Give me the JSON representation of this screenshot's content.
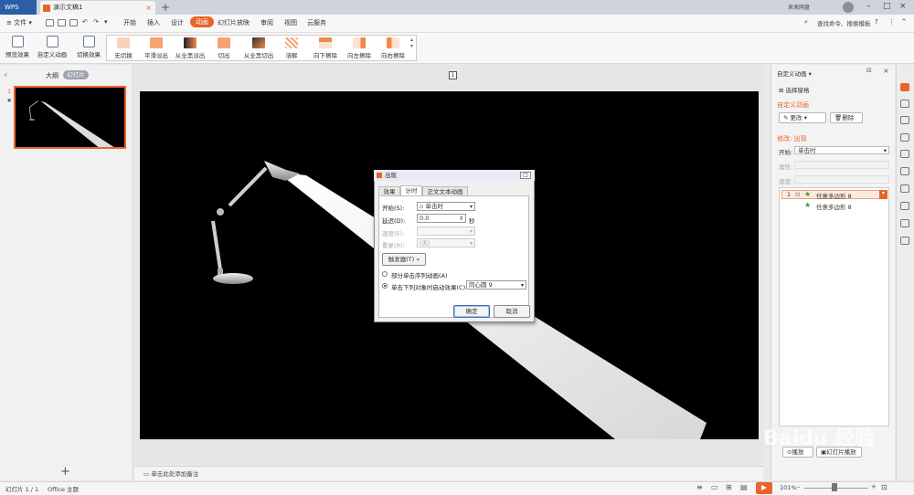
{
  "app": {
    "name": "WPS",
    "doc_tab": "演示文稿1",
    "user": "来来网盘"
  },
  "menu": {
    "file": "文件",
    "items": [
      "开始",
      "插入",
      "设计",
      "动画",
      "幻灯片放映",
      "审阅",
      "视图",
      "云服务"
    ],
    "active": "动画",
    "search": "查找命令、搜索模板"
  },
  "ribbon": {
    "left_buttons": [
      "预览效果",
      "自定义动画",
      "切换效果"
    ],
    "effects": [
      "无切换",
      "平滑淡出",
      "从全黑淡出",
      "切出",
      "从全黑切出",
      "溶解",
      "向下擦除",
      "向左擦除",
      "向右擦除"
    ]
  },
  "left": {
    "tab_outline": "大纲",
    "tab_slides": "幻灯片",
    "slide_num": "1"
  },
  "canvas": {
    "page_marker": "1",
    "notes": "单击此处添加备注"
  },
  "dialog": {
    "title": "出现",
    "tabs": [
      "效果",
      "计时",
      "正文文本动画"
    ],
    "start_label": "开始(S):",
    "start_value": "单击时",
    "delay_label": "延迟(D):",
    "delay_value": "0.0",
    "delay_unit": "秒",
    "speed_label": "速度(E):",
    "speed_value": "",
    "repeat_label": "重复(R):",
    "repeat_value": "(无)",
    "trigger_btn": "触发器(T)",
    "radio1": "部分单击序列动画(A)",
    "radio2": "单击下列对象时启动效果(C):",
    "radio2_value": "同心圆 9",
    "ok": "确定",
    "cancel": "取消"
  },
  "right": {
    "title": "自定义动画",
    "select_pane": "选择窗格",
    "custom_heading": "自定义动画",
    "change_btn": "更改",
    "delete_btn": "删除",
    "modify_heading": "修改: 出现",
    "start_label": "开始:",
    "start_value": "单击时",
    "prop_label": "属性:",
    "speed_label": "速度:",
    "items": [
      {
        "num": "1",
        "label": "任意多边形 8"
      },
      {
        "num": "",
        "label": "任意多边形 8"
      }
    ],
    "play_btn": "播放",
    "slideshow_btn": "幻灯片播放"
  },
  "status": {
    "slide": "幻灯片 1 / 1",
    "theme": "Office 主题",
    "zoom": "101%"
  },
  "watermark": "Baidu 经验"
}
